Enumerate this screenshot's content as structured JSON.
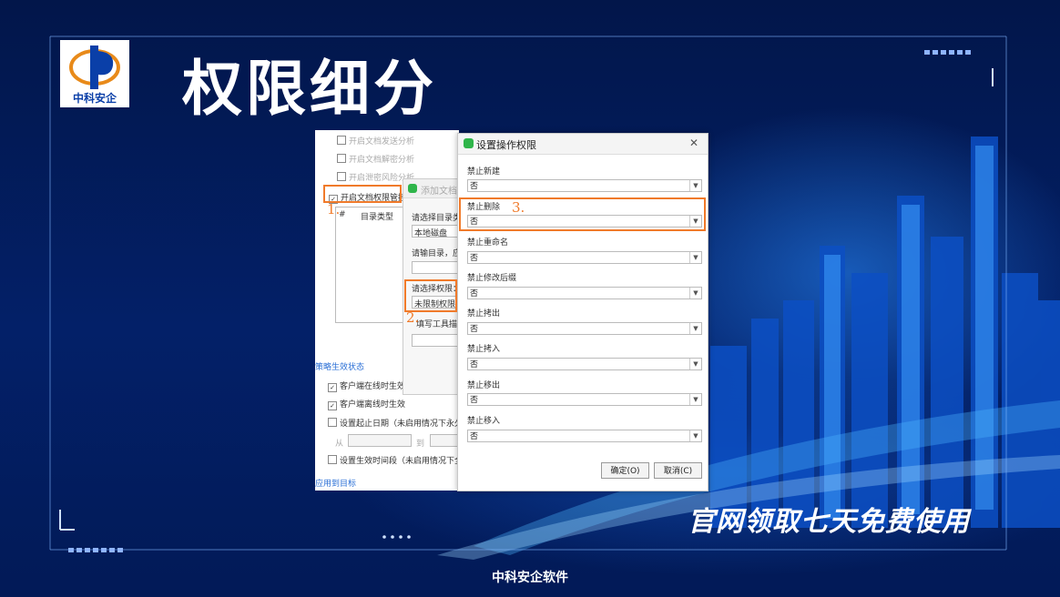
{
  "slide": {
    "title": "权限细分",
    "logo_text": "中科安企",
    "slogan": "官网领取七天免费使用",
    "footer": "中科安企软件"
  },
  "panel_left": {
    "options": [
      {
        "label": "开启文档发送分析",
        "checked": false
      },
      {
        "label": "开启文档解密分析",
        "checked": false
      },
      {
        "label": "开启泄密风险分析",
        "checked": false
      },
      {
        "label": "开启文档权限管控",
        "checked": true
      }
    ],
    "table_header": [
      "#",
      "目录类型"
    ],
    "section_title": "策略生效状态",
    "status_options": [
      {
        "label": "客户端在线时生效",
        "checked": true
      },
      {
        "label": "客户端离线时生效",
        "checked": true
      },
      {
        "label": "设置起止日期（未启用情况下永久",
        "checked": false
      }
    ],
    "from_label": "从",
    "to_label": "到",
    "time_option": "设置生效时间段（未启用情况下全",
    "apply_link": "应用到目标"
  },
  "panel_add": {
    "title": "添加文档",
    "select_dir_label": "请选择目录类",
    "dir_value": "本地磁盘",
    "input_dir_label": "请输目录，应",
    "select_perm_label": "请选择权限：",
    "perm_value": "未限制权限",
    "tool_label": "填写工具描"
  },
  "dialog": {
    "title": "设置操作权限",
    "close": "✕",
    "fields": [
      {
        "label": "禁止新建",
        "value": "否"
      },
      {
        "label": "禁止删除",
        "value": "否"
      },
      {
        "label": "禁止重命名",
        "value": "否"
      },
      {
        "label": "禁止修改后缀",
        "value": "否"
      },
      {
        "label": "禁止拷出",
        "value": "否"
      },
      {
        "label": "禁止拷入",
        "value": "否"
      },
      {
        "label": "禁止移出",
        "value": "否"
      },
      {
        "label": "禁止移入",
        "value": "否"
      }
    ],
    "ok": "确定(O)",
    "cancel": "取消(C)"
  },
  "callouts": [
    "1.",
    "2.",
    "3."
  ],
  "colors": {
    "highlight": "#f07a2a",
    "background": "#031a52",
    "link": "#2a6fd6"
  }
}
